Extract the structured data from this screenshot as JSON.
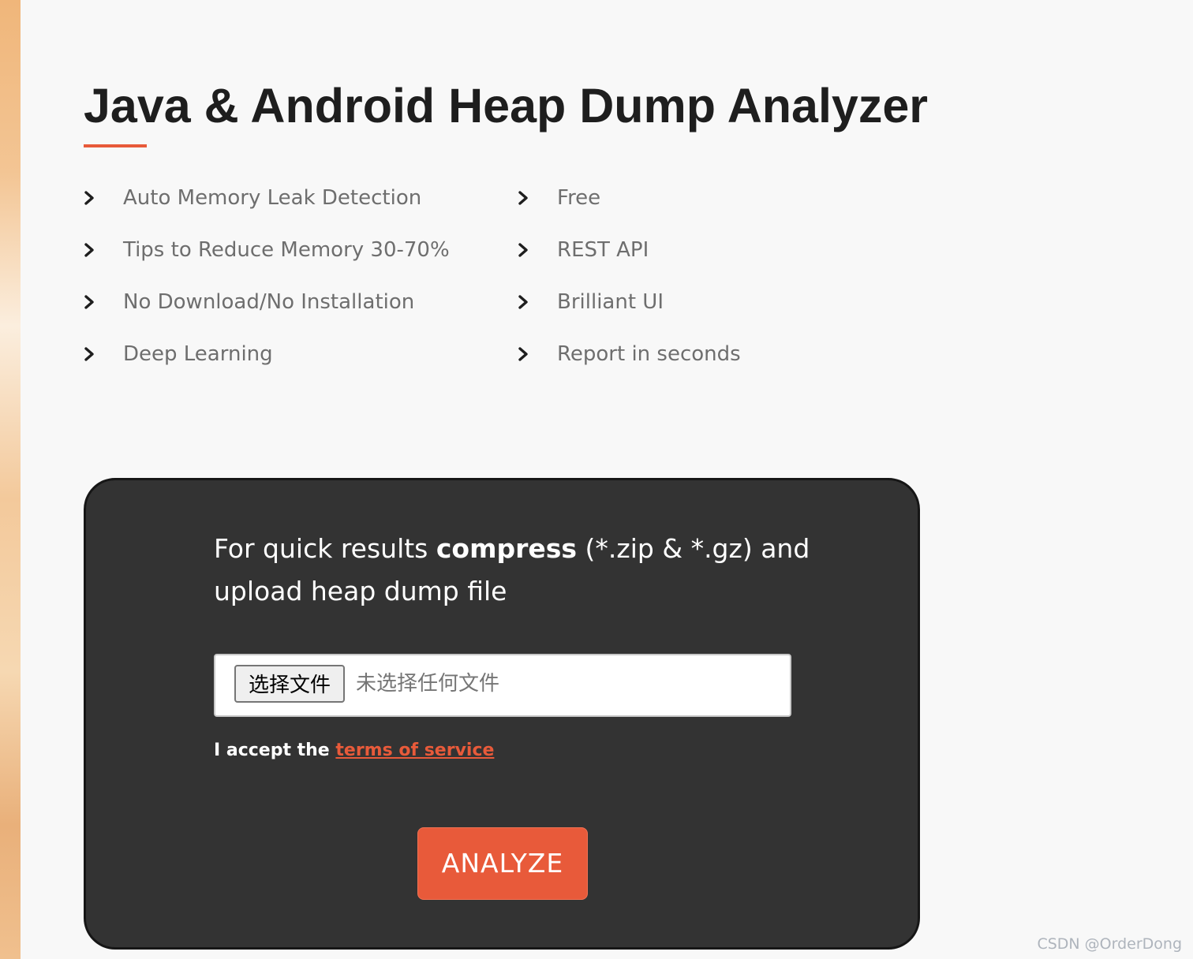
{
  "page": {
    "title": "Java & Android Heap Dump Analyzer",
    "accent_color": "#e85a3a",
    "background_color": "#f8f8f8",
    "card_color": "#333333"
  },
  "features": {
    "icon": "chevron-right-icon",
    "left": [
      "Auto Memory Leak Detection",
      "Tips to Reduce Memory 30-70%",
      "No Download/No Installation",
      "Deep Learning"
    ],
    "right": [
      "Free",
      "REST API",
      "Brilliant UI",
      "Report in seconds"
    ]
  },
  "upload": {
    "instruction_prefix": "For quick results ",
    "instruction_bold": "compress",
    "instruction_suffix": " (*.zip & *.gz) and upload heap dump file",
    "file_button_label": "选择文件",
    "file_status": "未选择任何文件",
    "terms_prefix": "I accept the ",
    "terms_link": "terms of service",
    "analyze_label": "ANALYZE"
  },
  "watermark": "CSDN @OrderDong"
}
